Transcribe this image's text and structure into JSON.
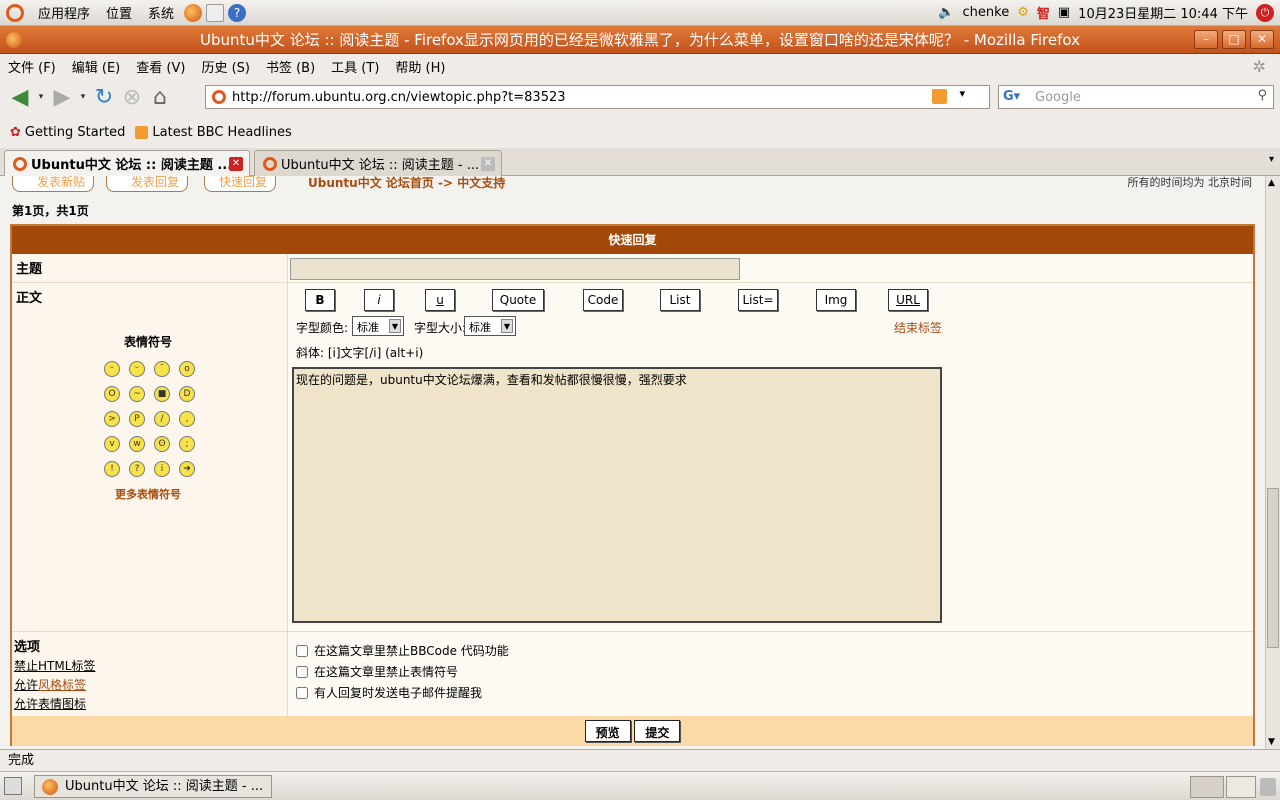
{
  "panel": {
    "menu": [
      "应用程序",
      "位置",
      "系统"
    ],
    "user": "chenke",
    "ime": "智",
    "datetime": "10月23日星期二 10:44 下午"
  },
  "window": {
    "title": "Ubuntu中文 论坛 :: 阅读主题 - Firefox显示网页用的已经是微软雅黑了，为什么菜单，设置窗口啥的还是宋体呢？ - Mozilla Firefox"
  },
  "menubar": [
    "文件 (F)",
    "编辑 (E)",
    "查看 (V)",
    "历史 (S)",
    "书签 (B)",
    "工具 (T)",
    "帮助 (H)"
  ],
  "nav": {
    "url": "http://forum.ubuntu.org.cn/viewtopic.php?t=83523",
    "search_placeholder": "Google"
  },
  "bookmarks": [
    "Getting Started",
    "Latest BBC Headlines"
  ],
  "tabs": [
    {
      "label": "Ubuntu中文 论坛 :: 阅读主题 ..."
    },
    {
      "label": "Ubuntu中文 论坛 :: 阅读主题 - ..."
    }
  ],
  "page": {
    "btn_new": "发表新贴",
    "btn_reply": "发表回复",
    "btn_quick": "快速回复",
    "crumb": "Ubuntu中文 论坛首页 -> 中文支持",
    "timezone": "所有的时间均为 北京时间",
    "pageinfo": "第1页，共1页",
    "quick_reply_title": "快速回复",
    "subject_label": "主题",
    "body_label": "正文",
    "smileys_title": "表情符号",
    "more_smileys": "更多表情符号",
    "bbcode": [
      "B",
      "i",
      "u",
      "Quote",
      "Code",
      "List",
      "List=",
      "Img",
      "URL"
    ],
    "font_color_label": "字型颜色:",
    "font_color_value": "标准",
    "font_size_label": "字型大小:",
    "font_size_value": "标准",
    "close_tags": "结束标签",
    "hint": "斜体: [i]文字[/i]  (alt+i)",
    "message": "现在的问题是，ubuntu中文论坛爆满，查看和发帖都很慢很慢，强烈要求",
    "options_label": "选项",
    "opt_html": "禁止HTML标签",
    "opt_bbcode_a": "允许",
    "opt_bbcode_b": "风格标签",
    "opt_smiley": "允许表情图标",
    "checks": [
      "在这篇文章里禁止BBCode 代码功能",
      "在这篇文章里禁止表情符号",
      "有人回复时发送电子邮件提醒我"
    ],
    "preview": "预览",
    "submit": "提交"
  },
  "status": "完成",
  "taskbar": {
    "item": "Ubuntu中文 论坛 :: 阅读主题 - ..."
  }
}
